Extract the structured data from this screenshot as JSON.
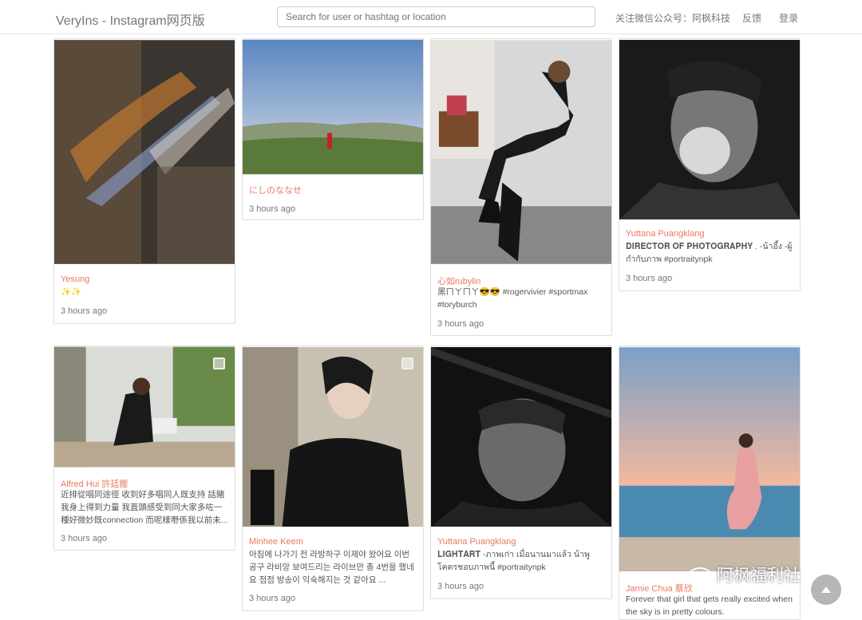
{
  "header": {
    "brand": "VeryIns - Instagram网页版",
    "search_placeholder": "Search for user or hashtag or location",
    "wechat": "关注微信公众号：阿枫科技",
    "feedback": "反馈",
    "login": "登录"
  },
  "posts": [
    {
      "user": "Yesung",
      "caption": "✨✨",
      "time": "3 hours ago"
    },
    {
      "user": "にしのななせ",
      "caption": "",
      "time": "3 hours ago"
    },
    {
      "user": "心如rubylin",
      "caption": "黑ㄇㄚㄇㄚ😎😎 #rogervivier #sportmax #toryburch",
      "time": "3 hours ago"
    },
    {
      "user": "Yuttana Puangklang",
      "caption": "𝐃𝐈𝐑𝐄𝐂𝐓𝐎𝐑 𝐎𝐅 𝐏𝐇𝐎𝐓𝐎𝐆𝐑𝐀𝐏𝐇𝐘 . -น้าอึ้ง -ผู้กำกับภาพ #portraitynpk",
      "time": "3 hours ago"
    },
    {
      "user": "Alfred Hui 許廷鏗",
      "caption": "近排從唱同途徑 收到好多唱同人既支持 話賭我身上得到力量 我直頭感受到同大家多咗一種好微妙既connection 而呢樣嘢係我以前未...",
      "time": "3 hours ago"
    },
    {
      "user": "Minhee Keem",
      "caption": "아침에 나가기 전 라방하구 이제야 왔어요 이번 공구 라비앙 보여드리는 라이브만 총 4번을 했네요 점점 방송이 익숙해지는 것 같아요 ...",
      "time": "3 hours ago"
    },
    {
      "user": "Yuttana Puangklang",
      "caption": "𝐋𝐈𝐆𝐇𝐓𝐀𝐑𝐓 -ภาพเก่า เมื่อนานมาแล้ว น้าพูโคตรชอบภาพนี้ #portraitynpk",
      "time": "3 hours ago"
    },
    {
      "user": "Jamie Chua 蔡欣",
      "caption": "Forever that girl that gets really excited when the sky is in pretty colours.",
      "time": ""
    }
  ],
  "watermark": "阿枫福利社"
}
